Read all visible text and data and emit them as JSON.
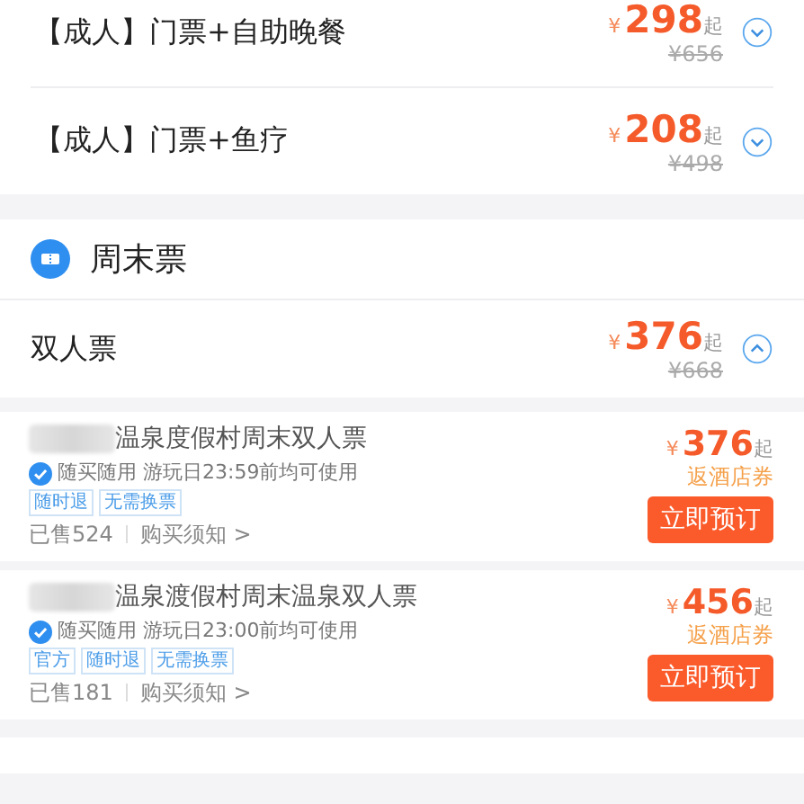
{
  "packages": [
    {
      "name": "【成人】门票+自助晚餐",
      "currency": "¥",
      "price": "298",
      "suffix": "起",
      "original": "¥656",
      "expanded": false
    },
    {
      "name": "【成人】门票+鱼疗",
      "currency": "¥",
      "price": "208",
      "suffix": "起",
      "original": "¥498",
      "expanded": false
    }
  ],
  "weekend": {
    "title": "周末票",
    "groups": [
      {
        "name": "双人票",
        "currency": "¥",
        "price": "376",
        "suffix": "起",
        "original": "¥668",
        "expanded": true,
        "offers": [
          {
            "title": "温泉度假村周末双人票",
            "usage": "随买随用 游玩日23:59前均可使用",
            "tags": [
              "随时退",
              "无需换票"
            ],
            "sold": "已售524",
            "notice": "购买须知 >",
            "currency": "¥",
            "price": "376",
            "suffix": "起",
            "perk": "返酒店券",
            "button": "立即预订"
          },
          {
            "title": "温泉渡假村周末温泉双人票",
            "usage": "随买随用 游玩日23:00前均可使用",
            "tags": [
              "官方",
              "随时退",
              "无需换票"
            ],
            "sold": "已售181",
            "notice": "购买须知 >",
            "currency": "¥",
            "price": "456",
            "suffix": "起",
            "perk": "返酒店券",
            "button": "立即预订"
          }
        ]
      }
    ]
  }
}
